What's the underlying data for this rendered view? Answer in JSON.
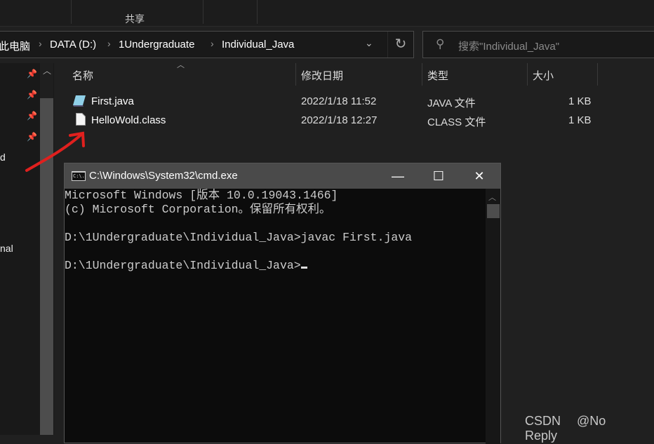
{
  "ribbon": {
    "share_tab": "共享"
  },
  "address": {
    "crumbs": [
      "此电脑",
      "DATA (D:)",
      "1Undergraduate",
      "Individual_Java"
    ]
  },
  "search": {
    "placeholder": "搜索\"Individual_Java\""
  },
  "nav": {
    "partial_items": [
      "d",
      "nal"
    ]
  },
  "columns": {
    "name": "名称",
    "modified": "修改日期",
    "type": "类型",
    "size": "大小"
  },
  "files": [
    {
      "name": "First.java",
      "modified": "2022/1/18 11:52",
      "type": "JAVA 文件",
      "size": "1 KB",
      "icon": "java-file-icon"
    },
    {
      "name": "HelloWold.class",
      "modified": "2022/1/18 12:27",
      "type": "CLASS 文件",
      "size": "1 KB",
      "icon": "blank-file-icon"
    }
  ],
  "cmd": {
    "title": "C:\\Windows\\System32\\cmd.exe",
    "icon_text": "C:\\.",
    "lines": [
      "Microsoft Windows [版本 10.0.19043.1466]",
      "(c) Microsoft Corporation。保留所有权利。",
      "",
      "D:\\1Undergraduate\\Individual_Java>javac First.java",
      "",
      "D:\\1Undergraduate\\Individual_Java>"
    ]
  },
  "annotation": {
    "arrow_color": "#e0201e"
  },
  "watermark": "CSDN @No Reply"
}
